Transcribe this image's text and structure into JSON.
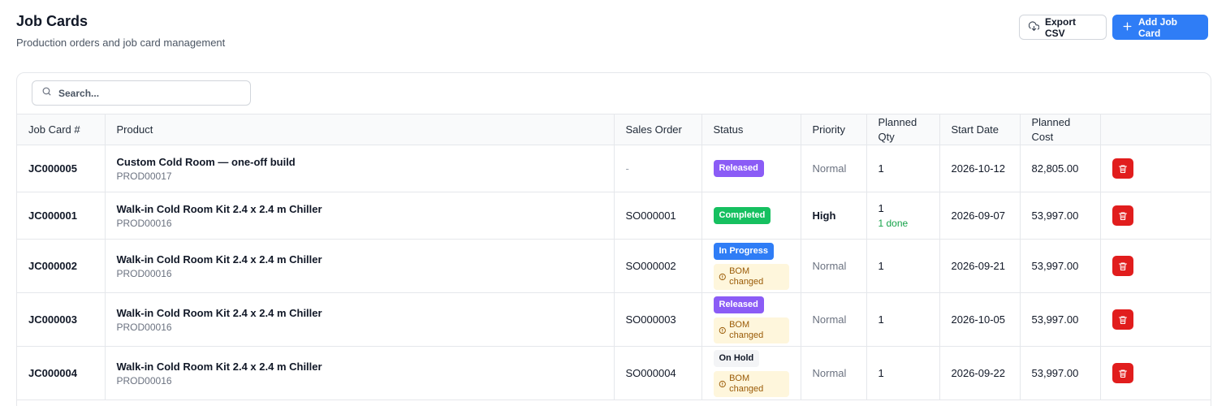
{
  "header": {
    "title": "Job Cards",
    "subtitle": "Production orders and job card management",
    "export_label": "Export CSV",
    "add_label": "Add Job Card"
  },
  "search": {
    "placeholder": "Search..."
  },
  "table": {
    "headers": [
      "Job Card #",
      "Product",
      "Sales Order",
      "Status",
      "Priority",
      "Planned Qty",
      "Start Date",
      "Planned Cost",
      ""
    ],
    "rows": [
      {
        "job_card": "JC000005",
        "product": "Custom Cold Room — one-off build",
        "product_code": "PROD00017",
        "sales_order": "-",
        "status": "Released",
        "bom": "",
        "priority": "Normal",
        "qty": "1",
        "qty_done": "",
        "start_date": "2026-10-12",
        "cost": "82,805.00"
      },
      {
        "job_card": "JC000001",
        "product": "Walk-in Cold Room Kit 2.4 x 2.4 m Chiller",
        "product_code": "PROD00016",
        "sales_order": "SO000001",
        "status": "Completed",
        "bom": "",
        "priority": "High",
        "qty": "1",
        "qty_done": "1 done",
        "start_date": "2026-09-07",
        "cost": "53,997.00"
      },
      {
        "job_card": "JC000002",
        "product": "Walk-in Cold Room Kit 2.4 x 2.4 m Chiller",
        "product_code": "PROD00016",
        "sales_order": "SO000002",
        "status": "In Progress",
        "bom": "BOM changed",
        "priority": "Normal",
        "qty": "1",
        "qty_done": "",
        "start_date": "2026-09-21",
        "cost": "53,997.00"
      },
      {
        "job_card": "JC000003",
        "product": "Walk-in Cold Room Kit 2.4 x 2.4 m Chiller",
        "product_code": "PROD00016",
        "sales_order": "SO000003",
        "status": "Released",
        "bom": "BOM changed",
        "priority": "Normal",
        "qty": "1",
        "qty_done": "",
        "start_date": "2026-10-05",
        "cost": "53,997.00"
      },
      {
        "job_card": "JC000004",
        "product": "Walk-in Cold Room Kit 2.4 x 2.4 m Chiller",
        "product_code": "PROD00016",
        "sales_order": "SO000004",
        "status": "On Hold",
        "bom": "BOM changed",
        "priority": "Normal",
        "qty": "1",
        "qty_done": "",
        "start_date": "2026-09-22",
        "cost": "53,997.00"
      }
    ]
  },
  "icons": {
    "export": "download-cloud-icon",
    "add": "plus-icon",
    "search": "search-icon",
    "bom": "info-circle-icon",
    "delete": "trash-icon"
  },
  "colors": {
    "primary": "#2f7df6",
    "released": "#8b5cf6",
    "completed": "#16c060",
    "in_progress": "#2f7df6",
    "on_hold": "#f3f4f6",
    "bom_bg": "#fef6dc",
    "danger": "#e11d1d"
  }
}
